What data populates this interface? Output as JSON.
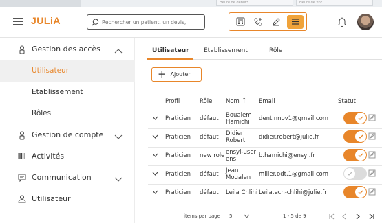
{
  "top_strip": {
    "start_placeholder": "Heure de début*",
    "end_placeholder": "Heure de fin*"
  },
  "header": {
    "logo": "JULiA",
    "search_placeholder": "Rechercher un patient, un devis,"
  },
  "sidebar": {
    "items": [
      {
        "label": "Gestion des accès",
        "icon": "user-lock-icon",
        "expanded": true
      },
      {
        "label": "Gestion de compte",
        "icon": "user-lock-icon",
        "expanded": false
      },
      {
        "label": "Activités",
        "icon": "barcode-icon"
      },
      {
        "label": "Communication",
        "icon": "message-icon",
        "expanded": false
      },
      {
        "label": "Utilisateur",
        "icon": "user-icon"
      }
    ],
    "subitems": [
      "Utilisateur",
      "Etablissement",
      "Rôles"
    ]
  },
  "tabs": [
    "Utilisateur",
    "Etablissement",
    "Rôle"
  ],
  "add_button": "Ajouter",
  "table": {
    "headers": [
      "Profil",
      "Rôle",
      "Nom",
      "Email",
      "Statut"
    ],
    "rows": [
      {
        "profil": "Praticien",
        "role": "défaut",
        "nom": "Boualem Hamichi",
        "email": "dentinnov1@gmail.com",
        "active": true
      },
      {
        "profil": "Praticien",
        "role": "défaut",
        "nom": "Didier Robert",
        "email": "didier.robert@julie.fr",
        "active": true
      },
      {
        "profil": "Praticien",
        "role": "new role",
        "nom": "ensyl-user ens",
        "email": "b.hamichi@ensyl.fr",
        "active": true
      },
      {
        "profil": "Praticien",
        "role": "défaut",
        "nom": "Jean Moualen",
        "email": "miller.odt.1@gmail.com",
        "active": false
      },
      {
        "profil": "Praticien",
        "role": "défaut",
        "nom": "Leila Chlihi",
        "email": "Leila.ech-chlihi@julie.fr",
        "active": true
      }
    ]
  },
  "pager": {
    "label": "items par page",
    "per_page": "5",
    "range": "1 - 5 de 9"
  },
  "colors": {
    "accent": "#e8862a"
  }
}
